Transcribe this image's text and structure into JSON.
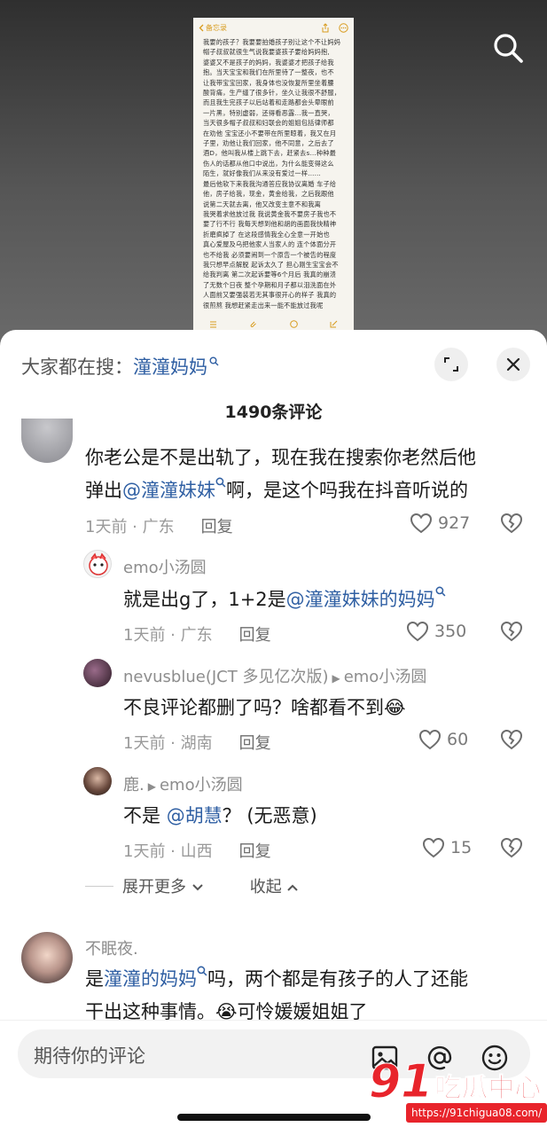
{
  "video": {
    "notes_back_label": "备忘录",
    "notes_lines": [
      "我要的孩子？我要要拍婚孩子别让这个不让妈妈",
      "帽子叔叔就很生气说我要婆孩子要给妈妈抱,",
      "婆婆又不是孩子的妈妈，我婆婆才把孩子给我",
      "抱。当天宝宝和我们在所里待了一整夜，也不",
      "让我带宝宝回家，我身体也没恢复所里坐着腰",
      "酸背痛，生产缝了很多针，坐久让我很不舒服，",
      "而且我生完孩子以后站着和走路都会头晕眼前",
      "一片黑，特别虚弱，还得看恶露…我一直哭，",
      "当天很多帽子叔叔和妇联会的姐姐包括律师都",
      "在劝他 宝宝还小不要带在所里晾着，我又在月",
      "子里，劝他让我们回家，他不同意，之后去了",
      "酒D，他叫我从楼上跳下去，赶紧去s…种种最",
      "伤人的话都从他口中说出，为什么能变得这么",
      "陌生，就好像我们从来没有爱过一样……",
      "最后他软下来我我沟通答应我协议离婚 车子给",
      "他，房子给我，现金，黄金给我，之后我跟他",
      "说第二天就去离，他又改变主意不和我离",
      "我哭着求他放过我  我说黄金我不要房子我也不",
      "要了行不行 我每天想到他和胡的画面我快精神",
      "折磨疯掉了  在这段感情我全心全意一开始也",
      "真心爱屋及乌把他家人当家人的  连个体面分开",
      "也不给我 必须要闹到一个原告一个被告的程度",
      "我只想早点解脱 起诉太久了 担心刚生宝宝会不",
      "给我判离 第二次起诉要等6个月后 我真的崩溃",
      "了无数个日夜 整个孕期和月子都以泪洗面在外",
      "人面前又要强装若无其事很开心的样子 我真的",
      "很煎熬 我想赶紧走出来一能不能放过我呢"
    ]
  },
  "sheet": {
    "trending_prefix": "大家都在搜：",
    "trending_keyword": "潼潼妈妈",
    "comment_count": "1490条评论"
  },
  "comments": [
    {
      "line1": "你老公是不是出轨了，现在我在搜索你老然后他",
      "line2_pre": "弹出",
      "line2_mention": "@潼潼妹妹",
      "line2_post": "啊，是这个吗我在抖音听说的",
      "time_loc": "1天前 · 广东",
      "reply": "回复",
      "likes": "927"
    },
    {
      "name": "emo小汤圆",
      "text_pre": "就是出g了，1+2是",
      "text_mention": "@潼潼妹妹的妈妈",
      "time_loc": "1天前 · 广东",
      "reply": "回复",
      "likes": "350"
    },
    {
      "name": "nevusblue(JCT 多见亿次版)",
      "reply_to": "emo小汤圆",
      "text_pre": "不良评论都删了吗？啥都看不到",
      "emoji": "😂",
      "time_loc": "1天前 · 湖南",
      "reply": "回复",
      "likes": "60"
    },
    {
      "name": "鹿.",
      "reply_to": "emo小汤圆",
      "text_pre": "不是",
      "text_mention": "@胡慧",
      "text_post": "？ (无恶意)",
      "time_loc": "1天前 · 山西",
      "reply": "回复",
      "likes": "15"
    },
    {
      "name": "不眠夜.",
      "line1_pre": "是",
      "line1_mention": "潼潼的妈妈",
      "line1_post": "吗，两个都是有孩子的人了还能",
      "line2_pre": "干出这种事情。",
      "emoji": "😭",
      "line2_post": "可怜媛媛姐姐了"
    }
  ],
  "expand": {
    "more": "展开更多",
    "collapse": "收起"
  },
  "input": {
    "placeholder": "期待你的评论"
  },
  "watermark": {
    "logo_num": "91",
    "logo_text": "吃瓜中心",
    "url": "https://91chigua08.com/"
  },
  "colors": {
    "mention": "#2f5fa3",
    "accent_red": "#e8242b",
    "notes_accent": "#d89b1d"
  }
}
